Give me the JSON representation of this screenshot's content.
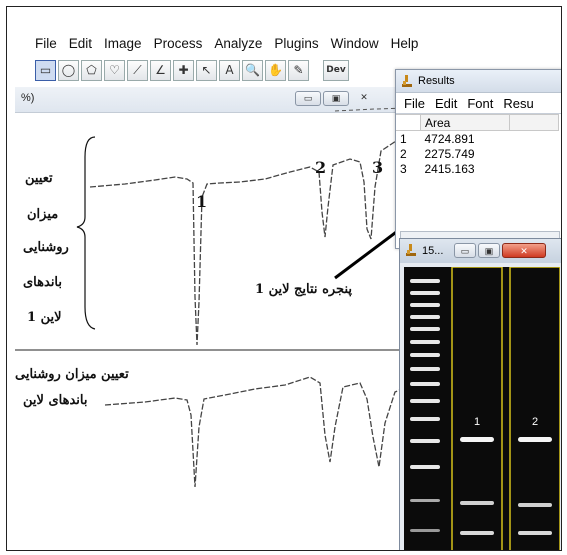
{
  "imagej": {
    "menu": [
      "File",
      "Edit",
      "Image",
      "Process",
      "Analyze",
      "Plugins",
      "Window",
      "Help"
    ],
    "tools": [
      "rectangle-tool-icon",
      "oval-tool-icon",
      "polygon-tool-icon",
      "freehand-tool-icon",
      "line-tool-icon",
      "angle-tool-icon",
      "point-tool-icon",
      "wand-tool-icon",
      "text-tool-icon",
      "magnifier-tool-icon",
      "hand-tool-icon",
      "dropper-tool-icon"
    ],
    "tool_symbols": [
      "▭",
      "◯",
      "⬠",
      "♡",
      "⟋",
      "∠",
      "✚",
      "↖",
      "A",
      "🔍",
      "✋",
      "✎"
    ],
    "toolbar_extra": "Dev"
  },
  "plot_window": {
    "title_fragment": "%)",
    "lane_numbers": [
      "1",
      "2",
      "3"
    ],
    "caption_left_top": [
      "تعیین",
      "میزان",
      "روشنایی",
      "باندهای",
      "لاین 1"
    ],
    "caption_left_bottom": [
      "تعیین میزان روشنایی",
      "باندهای لاین"
    ],
    "callout_label": "پنجره نتایج لاین 1"
  },
  "results_window": {
    "title": "Results",
    "menu": [
      "File",
      "Edit",
      "Font",
      "Resu"
    ],
    "column_header": "Area",
    "rows": [
      {
        "index": "1",
        "area": "4724.891"
      },
      {
        "index": "2",
        "area": "2275.749"
      },
      {
        "index": "3",
        "area": "2415.163"
      }
    ]
  },
  "gel_window": {
    "title": "15...",
    "lane_labels": [
      "1",
      "2"
    ],
    "lane_outline_color": "#d6c21a"
  },
  "colors": {
    "profile_line": "#444444",
    "callout_line": "#000000",
    "window_chrome": "#d4dde9"
  }
}
